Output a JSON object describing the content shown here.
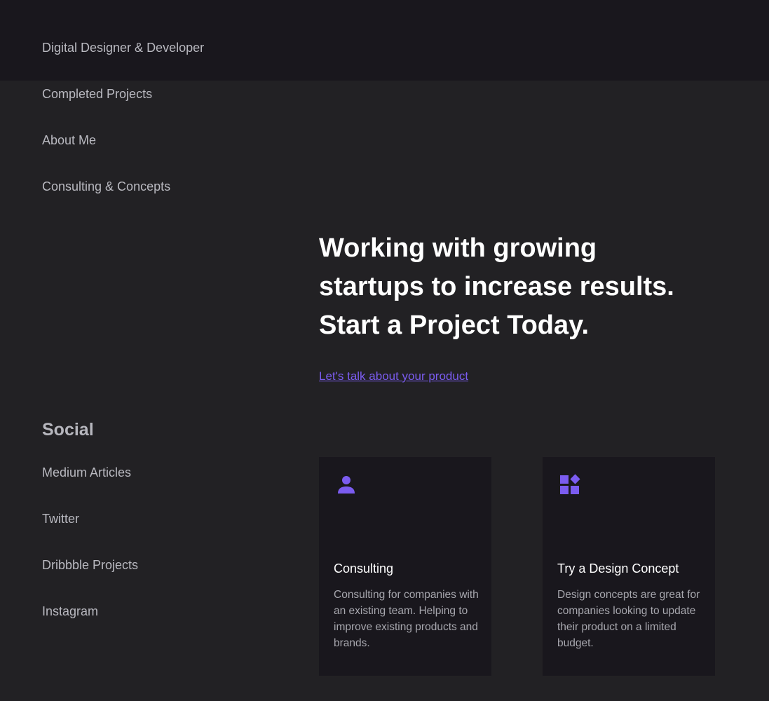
{
  "header": {
    "site_title": "Digital Designer & Developer"
  },
  "nav": {
    "items": [
      "Completed Projects",
      "About Me",
      "Consulting & Concepts"
    ]
  },
  "social": {
    "title": "Social",
    "items": [
      "Medium Articles",
      "Twitter",
      "Dribbble Projects",
      "Instagram"
    ]
  },
  "hero": {
    "lines": [
      "Working with growing",
      "startups to increase results.",
      "Start a Project Today."
    ],
    "cta_label": "Let's talk about your product"
  },
  "cards": [
    {
      "icon": "person-icon",
      "title": "Consulting",
      "description": "Consulting for companies with an existing team. Helping to improve existing products and brands."
    },
    {
      "icon": "widgets-icon",
      "title": "Try a Design Concept",
      "description": "Design concepts are great for companies looking to update their product on a limited budget."
    }
  ],
  "colors": {
    "background": "#222124",
    "topbar": "#19171d",
    "card": "#19171d",
    "accent": "#7b5cf0",
    "heading": "#ffffff",
    "nav_text": "#b9b9c0"
  }
}
